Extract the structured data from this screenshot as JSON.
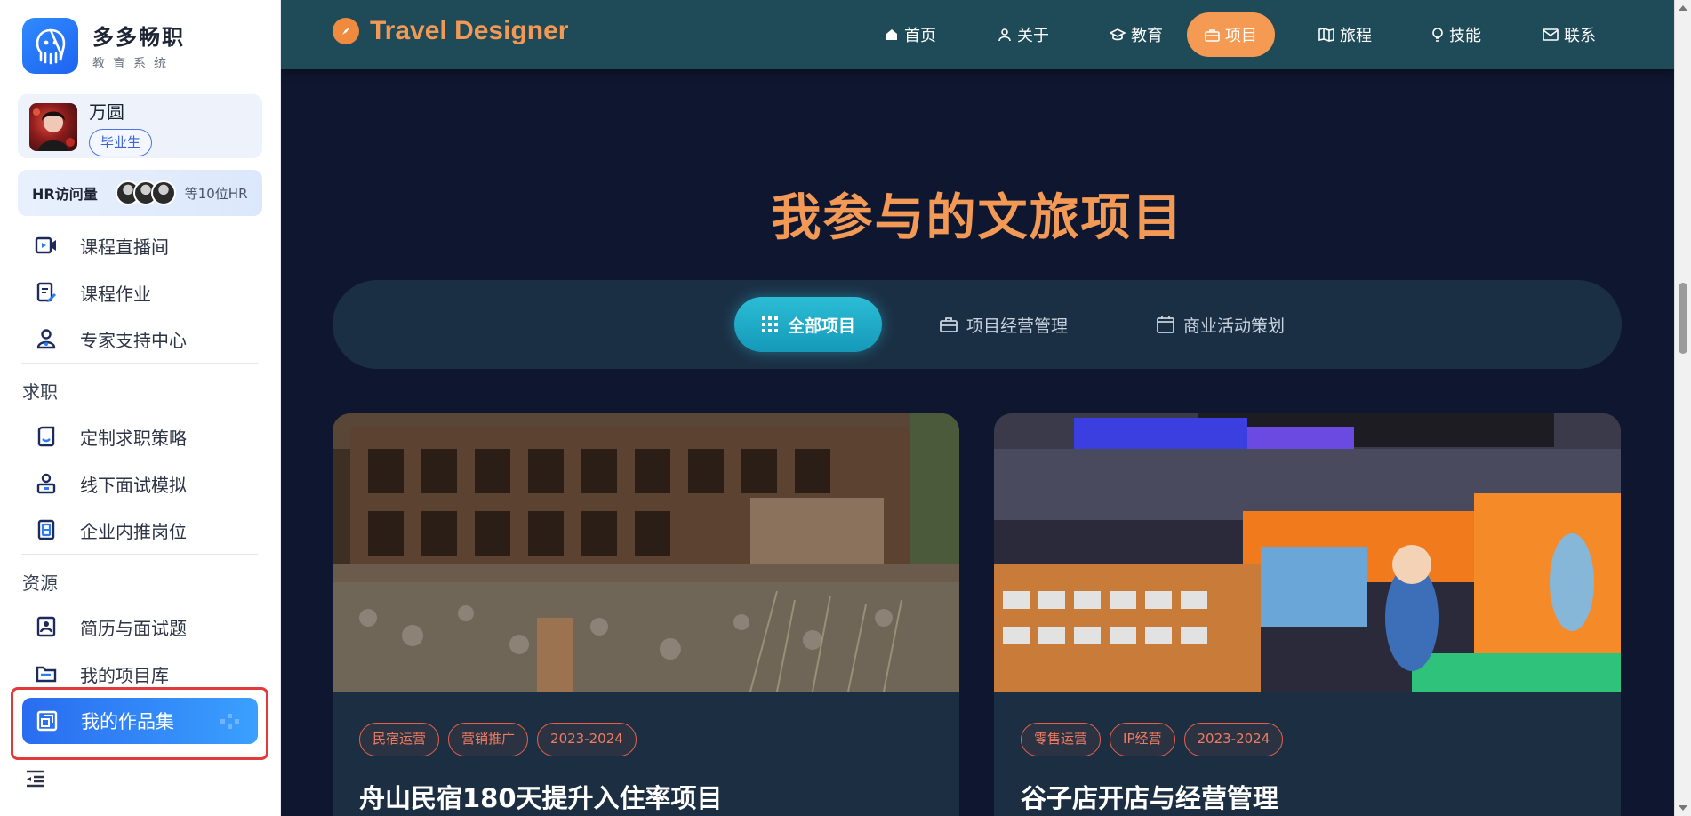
{
  "sidebar": {
    "logo_title": "多多畅职",
    "logo_subtitle": "教育系统",
    "user_name": "万圆",
    "user_badge": "毕业生",
    "hr_label": "HR访问量",
    "hr_count": "等10位HR",
    "items": [
      {
        "label": "课程直播间",
        "icon": "live-video-icon"
      },
      {
        "label": "课程作业",
        "icon": "homework-icon"
      },
      {
        "label": "专家支持中心",
        "icon": "expert-icon"
      },
      {
        "label": "定制求职策略",
        "icon": "strategy-icon"
      },
      {
        "label": "线下面试模拟",
        "icon": "interview-icon"
      },
      {
        "label": "企业内推岗位",
        "icon": "referral-icon"
      },
      {
        "label": "简历与面试题",
        "icon": "resume-icon"
      },
      {
        "label": "我的项目库",
        "icon": "folder-icon"
      },
      {
        "label": "我的作品集",
        "icon": "portfolio-icon"
      }
    ],
    "sections": [
      "求职",
      "资源"
    ],
    "accent": "#2a6cf0"
  },
  "nav": {
    "brand": "Travel Designer",
    "items": [
      {
        "label": "首页",
        "icon": "home-icon"
      },
      {
        "label": "关于",
        "icon": "user-icon"
      },
      {
        "label": "教育",
        "icon": "graduation-icon"
      },
      {
        "label": "项目",
        "icon": "briefcase-icon"
      },
      {
        "label": "旅程",
        "icon": "map-icon"
      },
      {
        "label": "技能",
        "icon": "bulb-icon"
      },
      {
        "label": "联系",
        "icon": "mail-icon"
      }
    ],
    "active": "项目",
    "accent": "#f59a52"
  },
  "main": {
    "title": "我参与的文旅项目",
    "tabs": [
      {
        "label": "全部项目",
        "icon": "grid-icon"
      },
      {
        "label": "项目经营管理",
        "icon": "briefcase-icon"
      },
      {
        "label": "商业活动策划",
        "icon": "calendar-icon"
      }
    ],
    "cards": [
      {
        "tags": [
          "民宿运营",
          "营销推广",
          "2023-2024"
        ],
        "title": "舟山民宿180天提升入住率项目"
      },
      {
        "tags": [
          "零售运营",
          "IP经营",
          "2023-2024"
        ],
        "title": "谷子店开店与经营管理"
      }
    ]
  }
}
